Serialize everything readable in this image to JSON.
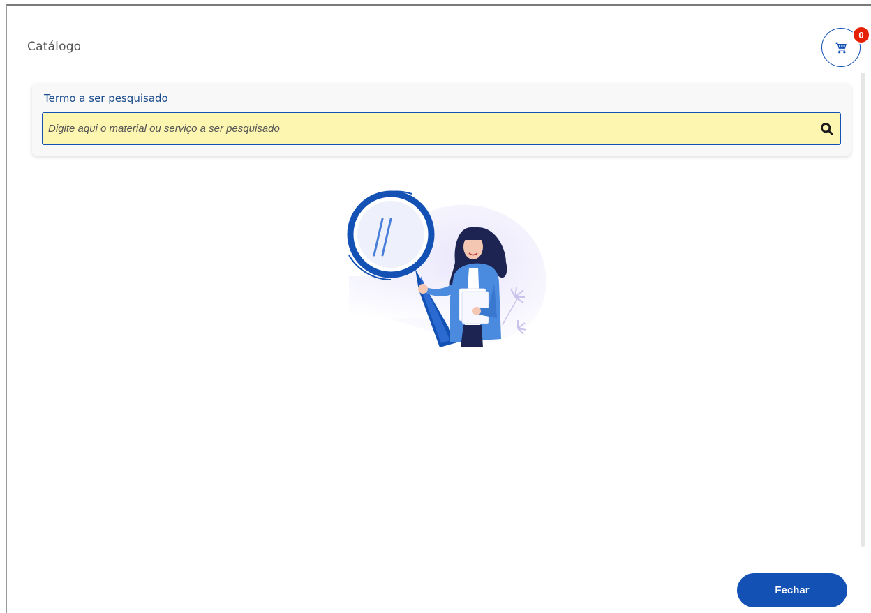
{
  "modal": {
    "title": "Catálogo"
  },
  "cart": {
    "count": "0",
    "icon": "cart-icon",
    "badge_color": "#e52207"
  },
  "search": {
    "label": "Termo a ser pesquisado",
    "value": "",
    "placeholder": "Digite aqui o material ou serviço a ser pesquisado",
    "icon": "search-icon",
    "field_color": "#fdf6b0"
  },
  "illustration": {
    "name": "woman-with-magnifying-glass-illustration"
  },
  "footer": {
    "close_label": "Fechar"
  },
  "colors": {
    "primary": "#1351b4",
    "label": "#1a4b8c"
  }
}
